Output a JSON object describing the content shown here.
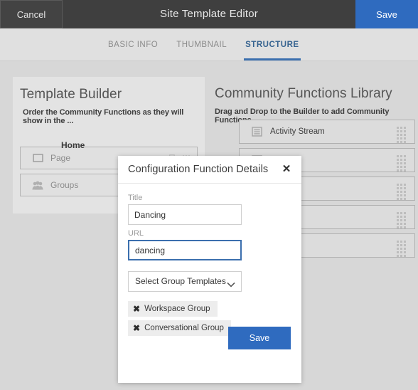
{
  "topbar": {
    "cancel_label": "Cancel",
    "title": "Site Template Editor",
    "save_label": "Save",
    "bg_color": "#3f3f3f",
    "accent_color": "#2f6bbf"
  },
  "tabs": [
    {
      "label": "BASIC INFO",
      "active": false
    },
    {
      "label": "THUMBNAIL",
      "active": false
    },
    {
      "label": "STRUCTURE",
      "active": true
    }
  ],
  "builder": {
    "title": "Template Builder",
    "subtitle": "Order the Community Functions as they will show in the ...",
    "drag_ghost_label": "Home",
    "rows": [
      {
        "label": "Page",
        "icon": "page-icon"
      },
      {
        "label": "Groups",
        "icon": "groups-icon"
      }
    ]
  },
  "library": {
    "title": "Community Functions Library",
    "subtitle": "Drag and Drop to the Builder to add Community Functions",
    "rows": [
      {
        "label": "Activity Stream",
        "icon": "list-icon"
      },
      {
        "label": "",
        "icon": "list-icon"
      },
      {
        "label": "",
        "icon": "list-icon"
      },
      {
        "label": "",
        "icon": "list-icon"
      },
      {
        "label": "",
        "icon": "list-icon"
      }
    ]
  },
  "modal": {
    "title": "Configuration Function Details",
    "close_label": "✕",
    "title_field": {
      "label": "Title",
      "value": "Dancing"
    },
    "url_field": {
      "label": "URL",
      "value": "dancing"
    },
    "select": {
      "placeholder": "Select Group Templates"
    },
    "tags": [
      {
        "label": "Workspace Group",
        "remove": "✖"
      },
      {
        "label": "Conversational Group",
        "remove": "✖"
      }
    ],
    "save_label": "Save"
  }
}
